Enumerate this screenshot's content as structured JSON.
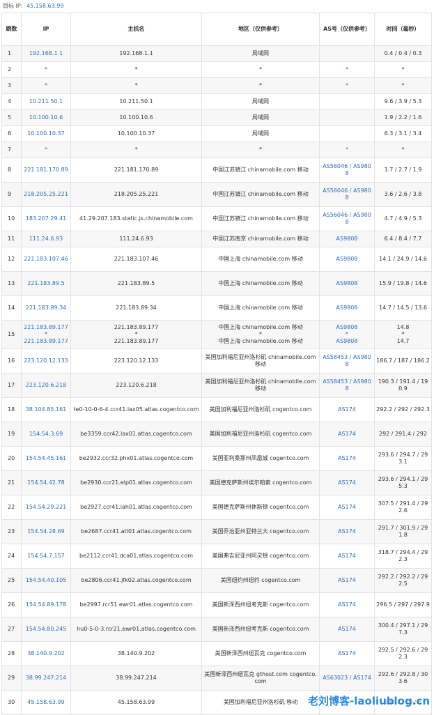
{
  "target": {
    "label": "目标 IP:",
    "ip": "45.158.63.99"
  },
  "headers": [
    "跳数",
    "IP",
    "主机名",
    "地区（仅供参考）",
    "AS号（仅供参考）",
    "时间（毫秒）"
  ],
  "rows": [
    {
      "hop": "1",
      "ip": "192.168.1.1",
      "host": "192.168.1.1",
      "region": "局域网",
      "as": "",
      "time": "0.4 / 0.4 / 0.3",
      "h": 23
    },
    {
      "hop": "2",
      "ip": "*",
      "host": "*",
      "region": "*",
      "as": "*",
      "time": "*",
      "h": 23
    },
    {
      "hop": "3",
      "ip": "*",
      "host": "*",
      "region": "*",
      "as": "*",
      "time": "*",
      "h": 23
    },
    {
      "hop": "4",
      "ip": "10.211.50.1",
      "host": "10.211.50.1",
      "region": "局域网",
      "as": "",
      "time": "9.6 / 3.9 / 5.3",
      "h": 23
    },
    {
      "hop": "5",
      "ip": "10.100.10.6",
      "host": "10.100.10.6",
      "region": "局域网",
      "as": "",
      "time": "1.9 / 2.2 / 1.6",
      "h": 23
    },
    {
      "hop": "6",
      "ip": "10.100.10.37",
      "host": "10.100.10.37",
      "region": "局域网",
      "as": "",
      "time": "6.3 / 3.1 / 3.4",
      "h": 23
    },
    {
      "hop": "7",
      "ip": "*",
      "host": "*",
      "region": "*",
      "as": "*",
      "time": "*",
      "h": 23
    },
    {
      "hop": "8",
      "ip": "221.181.170.89",
      "host": "221.181.170.89",
      "region": "中国江苏镇江 chinamobile.com 移动",
      "as": "AS56046 / AS9808",
      "time": "1.7 / 2.7 / 1.9",
      "h": 35
    },
    {
      "hop": "9",
      "ip": "218.205.25.221",
      "host": "218.205.25.221",
      "region": "中国江苏镇江 chinamobile.com 移动",
      "as": "AS56046 / AS9808",
      "time": "3.6 / 2.6 / 3.8",
      "h": 35
    },
    {
      "hop": "10",
      "ip": "183.207.29.41",
      "host": "41.29.207.183.static.js.chinamobile.com",
      "region": "中国江苏镇江 chinamobile.com 移动",
      "as": "AS56046 / AS9808",
      "time": "4.7 / 4.9 / 5.3",
      "h": 35
    },
    {
      "hop": "11",
      "ip": "111.24.6.93",
      "host": "111.24.6.93",
      "region": "中国江苏南京 chinamobile.com 移动",
      "as": "AS9808",
      "time": "6.4 / 8.4 / 7.7",
      "h": 23
    },
    {
      "hop": "12",
      "ip": "221.183.107.46",
      "host": "221.183.107.46",
      "region": "中国上海 chinamobile.com 移动",
      "as": "AS9808",
      "time": "14.1 / 24.9 / 14.6",
      "h": 35
    },
    {
      "hop": "13",
      "ip": "221.183.89.5",
      "host": "221.183.89.5",
      "region": "中国上海 chinamobile.com 移动",
      "as": "AS9808",
      "time": "15.9 / 19.8 / 14.6",
      "h": 35
    },
    {
      "hop": "14",
      "ip": "221.183.89.34",
      "host": "221.183.89.34",
      "region": "中国上海 chinamobile.com 移动",
      "as": "AS9808",
      "time": "14.7 / 14.5 / 13.6",
      "h": 35
    },
    {
      "hop": "15",
      "ip": "221.183.89.177\n*\n221.183.89.177",
      "host": "221.183.89.177\n*\n221.183.89.177",
      "region": "中国上海 chinamobile.com 移动\n*\n中国上海 chinamobile.com 移动",
      "as": "AS9808\n*\nAS9808",
      "time": "14.8\n*\n14.7",
      "h": 41
    },
    {
      "hop": "16",
      "ip": "223.120.12.133",
      "host": "223.120.12.133",
      "region": "美国加利福尼亚州洛杉矶 chinamobile.com 移动",
      "as": "AS58453 / AS9808",
      "time": "186.7 / 187 / 186.2",
      "h": 35
    },
    {
      "hop": "17",
      "ip": "223.120.6.218",
      "host": "223.120.6.218",
      "region": "美国加利福尼亚州洛杉矶 chinamobile.com 移动",
      "as": "AS58453 / AS9808",
      "time": "190.3 / 191.4 / 190.9",
      "h": 35
    },
    {
      "hop": "18",
      "ip": "38.104.85.161",
      "host": "te0-10-0-6-4.ccr41.lax05.atlas.cogentco.com",
      "region": "美国加利福尼亚州洛杉矶 cogentco.com",
      "as": "AS174",
      "time": "292.2 / 292 / 292.3",
      "h": 35
    },
    {
      "hop": "19",
      "ip": "154.54.3.69",
      "host": "be3359.ccr42.lax01.atlas.cogentco.com",
      "region": "美国加利福尼亚州洛杉矶 cogentco.com",
      "as": "AS174",
      "time": "292 / 291.4 / 292",
      "h": 35
    },
    {
      "hop": "20",
      "ip": "154.54.45.161",
      "host": "be2932.ccr32.phx01.atlas.cogentco.com",
      "region": "美国亚利桑那州凤凰城 cogentco.com",
      "as": "AS174",
      "time": "293.6 / 294.7 / 293.1",
      "h": 35
    },
    {
      "hop": "21",
      "ip": "154.54.42.78",
      "host": "be2930.ccr21.elp01.atlas.cogentco.com",
      "region": "美国德克萨斯州埃尔帕索 cogentco.com",
      "as": "AS174",
      "time": "293.6 / 294.1 / 295.3",
      "h": 35
    },
    {
      "hop": "22",
      "ip": "154.54.29.221",
      "host": "be2927.ccr41.iah01.atlas.cogentco.com",
      "region": "美国德克萨斯州休斯顿 cogentco.com",
      "as": "AS174",
      "time": "307.5 / 291.4 / 292.6",
      "h": 35
    },
    {
      "hop": "23",
      "ip": "154.54.28.69",
      "host": "be2687.ccr41.atl01.atlas.cogentco.com",
      "region": "美国乔治亚州亚特兰大 cogentco.com",
      "as": "AS174",
      "time": "291.7 / 301.9 / 291.8",
      "h": 35
    },
    {
      "hop": "24",
      "ip": "154.54.7.157",
      "host": "be2112.ccr41.dca01.atlas.cogentco.com",
      "region": "美国弗吉尼亚州阿灵顿 cogentco.com",
      "as": "AS174",
      "time": "318.7 / 294.4 / 292.3",
      "h": 35
    },
    {
      "hop": "25",
      "ip": "154.54.40.105",
      "host": "be2806.ccr41.jfk02.atlas.cogentco.com",
      "region": "美国纽约州纽约 cogentco.com",
      "as": "AS174",
      "time": "292.2 / 292.2 / 292.5",
      "h": 35
    },
    {
      "hop": "26",
      "ip": "154.54.89.178",
      "host": "be2997.rcr51.ewr01.atlas.cogentco.com",
      "region": "美国新泽西州纽考克斯 cogentco.com",
      "as": "AS174",
      "time": "296.5 / 297 / 297.9",
      "h": 35
    },
    {
      "hop": "27",
      "ip": "154.54.80.245",
      "host": "hu0-5-0-3.rcr21.ewr01.atlas.cogentco.com",
      "region": "美国新泽西州纽考克斯 cogentco.com",
      "as": "AS174",
      "time": "300.4 / 297.1 / 297.3",
      "h": 35
    },
    {
      "hop": "28",
      "ip": "38.140.9.202",
      "host": "38.140.9.202",
      "region": "美国新泽西州纽瓦克 cogentco.com",
      "as": "AS174",
      "time": "292.5 / 292.6 / 292.3",
      "h": 35
    },
    {
      "hop": "29",
      "ip": "38.99.247.214",
      "host": "38.99.247.214",
      "region": "美国新泽西州纽瓦克 gthost.com cogentco.com",
      "as": "AS63023 / AS174",
      "time": "292.6 / 292.8 / 303.6",
      "h": 35
    },
    {
      "hop": "30",
      "ip": "45.158.63.99",
      "host": "45.158.63.99",
      "region": "美国加利福尼亚州洛杉矶 移动",
      "as": "",
      "time": "292.7 / 292.6",
      "h": 35
    }
  ],
  "watermark": "老刘博客-laoliublog.cn",
  "colors": {
    "link": "#2a6ebb",
    "border": "#e2e2e2",
    "stripe": "#f7f7f7",
    "watermark": "#1e7fd6"
  }
}
